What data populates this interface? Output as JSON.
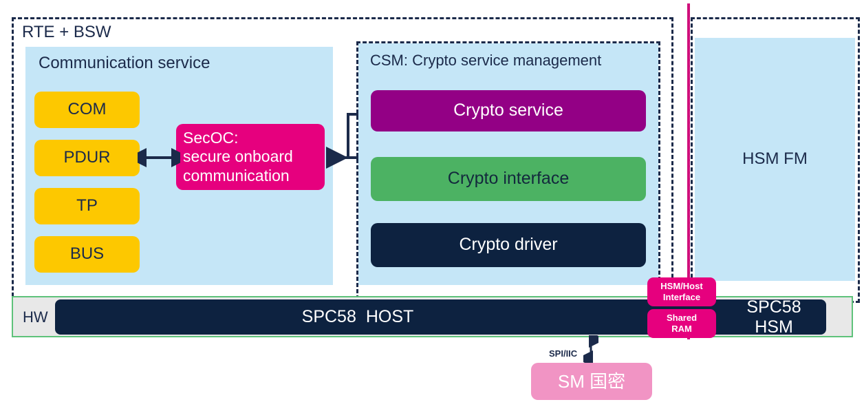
{
  "diagram": {
    "title_rte": "RTE + BSW",
    "hw_label": "HW"
  },
  "comm_service": {
    "title": "Communication service",
    "modules": [
      {
        "label": "COM"
      },
      {
        "label": "PDUR"
      },
      {
        "label": "TP"
      },
      {
        "label": "BUS"
      }
    ]
  },
  "secoc": {
    "line1": "SecOC:",
    "line2": "secure onboard",
    "line3": "communication"
  },
  "csm": {
    "title": "CSM: Crypto service management",
    "layers": [
      {
        "label": "Crypto service"
      },
      {
        "label": "Crypto interface"
      },
      {
        "label": "Crypto driver"
      }
    ]
  },
  "hsm_fm": {
    "label": "HSM FM"
  },
  "hardware": {
    "host_line1": "SPC58",
    "host_line2": "HOST",
    "hsm_line1": "SPC58",
    "hsm_line2": "HSM",
    "hsm_host_interface_line1": "HSM/Host",
    "hsm_host_interface_line2": "Interface",
    "shared_ram_line1": "Shared",
    "shared_ram_line2": "RAM"
  },
  "sm": {
    "bus_label": "SPI/IIC",
    "label": "SM 国密"
  },
  "colors": {
    "light_blue": "#c5e6f7",
    "yellow": "#fdc800",
    "pink": "#e6007e",
    "purple": "#930085",
    "green": "#4cb263",
    "navy": "#0d2240",
    "light_pink": "#f194c4",
    "dashed_border": "#1b2a4a",
    "hw_border_green": "#5ec27a",
    "magenta_divider": "#cf0f7b",
    "hw_fill": "#e8e8e8"
  }
}
